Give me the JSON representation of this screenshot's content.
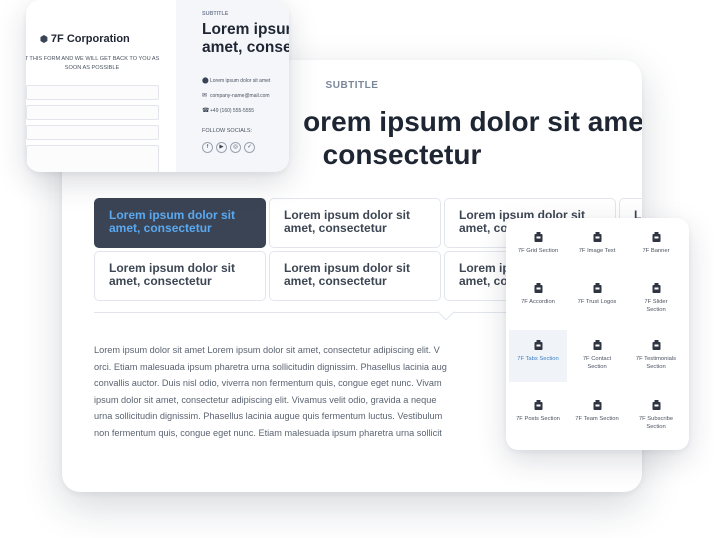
{
  "main": {
    "subtitle": "SUBTITLE",
    "heading_line1": "orem ipsum dolor sit amet,",
    "heading_line2": "consectetur",
    "tabs": [
      {
        "line1": "Lorem ipsum dolor sit",
        "line2": "amet, consectetur",
        "active": true
      },
      {
        "line1": "Lorem ipsum dolor sit",
        "line2": "amet, consectetur"
      },
      {
        "line1": "Lorem ipsum dolor sit",
        "line2": "amet, co"
      },
      {
        "line1": "L",
        "line2": ""
      },
      {
        "line1": "Lorem ipsum dolor sit",
        "line2": "amet, consectetur"
      },
      {
        "line1": "Lorem ipsum dolor sit",
        "line2": "amet, consectetur"
      },
      {
        "line1": "Lorem ip",
        "line2": "amet, co"
      }
    ],
    "body_lines": [
      "Lorem ipsum dolor sit amet Lorem ipsum dolor sit amet, consectetur adipiscing elit. V",
      "orci. Etiam malesuada ipsum pharetra urna sollicitudin dignissim. Phasellus lacinia aug",
      "convallis auctor. Duis nisl odio, viverra non fermentum quis, congue eget nunc. Vivam",
      "ipsum dolor sit amet, consectetur adipiscing elit. Vivamus velit odio, gravida a neque",
      "urna sollicitudin dignissim. Phasellus lacinia augue quis fermentum luctus. Vestibulum",
      "non fermentum quis, congue eget nunc. Etiam malesuada ipsum pharetra urna sollicit"
    ]
  },
  "contact": {
    "brand": "7F Corporation",
    "notice_line1": "T THIS FORM AND WE WILL GET BACK TO YOU AS",
    "notice_line2": "SOON AS POSSIBLE",
    "subtitle": "SUBTITLE",
    "heading_line1": "Lorem ipsur",
    "heading_line2": "amet, conse",
    "address": "Lorem ipsum dolor sit amet",
    "email": "company-name@mail.com",
    "phone": "+49 (160) 555-5555",
    "follow_label": "FOLLOW SOCIALS:",
    "socials": [
      {
        "name": "facebook",
        "glyph": "f"
      },
      {
        "name": "youtube",
        "glyph": "▶"
      },
      {
        "name": "instagram",
        "glyph": "◎"
      },
      {
        "name": "twitter",
        "glyph": "✓"
      }
    ]
  },
  "widgets": {
    "items": [
      {
        "label1": "7F Grid Section",
        "label2": ""
      },
      {
        "label1": "7F Image Text",
        "label2": ""
      },
      {
        "label1": "7F Banner",
        "label2": ""
      },
      {
        "label1": "7F Accordion",
        "label2": ""
      },
      {
        "label1": "7F Trust Logos",
        "label2": ""
      },
      {
        "label1": "7F Slider",
        "label2": "Section"
      },
      {
        "label1": "7F Tabs Section",
        "label2": "",
        "active": true
      },
      {
        "label1": "7F Contact",
        "label2": "Section"
      },
      {
        "label1": "7F Testimonials",
        "label2": "Section"
      },
      {
        "label1": "7F Posts Section",
        "label2": ""
      },
      {
        "label1": "7F Team Section",
        "label2": ""
      },
      {
        "label1": "7F Subscribe",
        "label2": "Section"
      }
    ],
    "icon_name": "widget-block-icon",
    "colors": {
      "accent_active": "#3a7ec6",
      "tab_active_bg": "#3b4454",
      "tab_active_text": "#5aa9f0"
    }
  }
}
